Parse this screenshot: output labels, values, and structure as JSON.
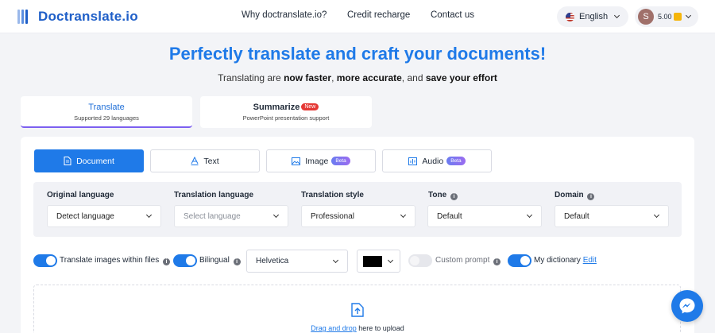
{
  "brand": {
    "name": "Doctranslate.io"
  },
  "nav": {
    "why": "Why doctranslate.io?",
    "credit": "Credit recharge",
    "contact": "Contact us"
  },
  "language": {
    "label": "English"
  },
  "user": {
    "initial": "S",
    "credits": "5.00"
  },
  "hero": {
    "title": "Perfectly translate and craft your documents!",
    "sub_1": "Translating are ",
    "sub_b1": "now faster",
    "sub_2": ", ",
    "sub_b2": "more accurate",
    "sub_3": ", and ",
    "sub_b3": "save your effort"
  },
  "modes": [
    {
      "title": "Translate",
      "subtitle": "Supported 29 languages"
    },
    {
      "title": "Summarize",
      "badge": "New",
      "subtitle": "PowerPoint presentation support"
    }
  ],
  "types": [
    {
      "label": "Document"
    },
    {
      "label": "Text"
    },
    {
      "label": "Image",
      "badge": "Beta"
    },
    {
      "label": "Audio",
      "badge": "Beta"
    }
  ],
  "settings": [
    {
      "label": "Original language",
      "value": "Detect language"
    },
    {
      "label": "Translation language",
      "value": "Select language"
    },
    {
      "label": "Translation style",
      "value": "Professional"
    },
    {
      "label": "Tone",
      "value": "Default"
    },
    {
      "label": "Domain",
      "value": "Default"
    }
  ],
  "options": {
    "translate_images": "Translate images within files",
    "bilingual": "Bilingual",
    "font": "Helvetica",
    "custom_prompt": "Custom prompt",
    "my_dictionary": "My dictionary",
    "edit": "Edit"
  },
  "upload": {
    "link": "Drag and drop",
    "rest": " here to upload"
  },
  "colors": {
    "accent": "#1f7ae8",
    "text_color_swatch": "#000000"
  }
}
